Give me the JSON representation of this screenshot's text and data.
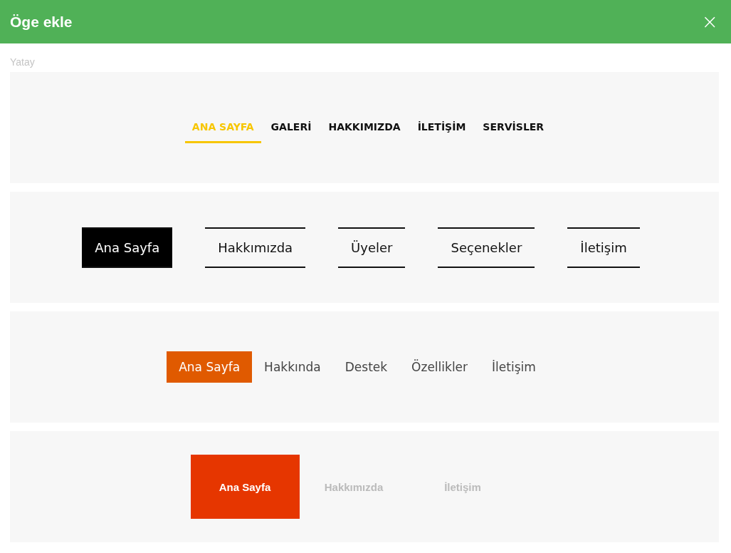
{
  "dialog": {
    "title": "Öge ekle",
    "close_icon": "×"
  },
  "section_label": "Yatay",
  "menus": [
    {
      "kind": "underline",
      "items": [
        {
          "label": "ANA SAYFA",
          "selected": true
        },
        {
          "label": "GALERİ",
          "selected": false
        },
        {
          "label": "HAKKIMIZDA",
          "selected": false
        },
        {
          "label": "İLETİŞİM",
          "selected": false
        },
        {
          "label": "SERVİSLER",
          "selected": false
        }
      ]
    },
    {
      "kind": "bordered",
      "items": [
        {
          "label": "Ana Sayfa",
          "selected": true
        },
        {
          "label": "Hakkımızda",
          "selected": false
        },
        {
          "label": "Üyeler",
          "selected": false
        },
        {
          "label": "Seçenekler",
          "selected": false
        },
        {
          "label": "İletişim",
          "selected": false
        }
      ]
    },
    {
      "kind": "pill",
      "items": [
        {
          "label": "Ana Sayfa",
          "selected": true
        },
        {
          "label": "Hakkında",
          "selected": false
        },
        {
          "label": "Destek",
          "selected": false
        },
        {
          "label": "Özellikler",
          "selected": false
        },
        {
          "label": "İletişim",
          "selected": false
        }
      ]
    },
    {
      "kind": "block",
      "items": [
        {
          "label": "Ana Sayfa",
          "selected": true
        },
        {
          "label": "Hakkımızda",
          "selected": false
        },
        {
          "label": "İletişim",
          "selected": false
        }
      ]
    }
  ]
}
